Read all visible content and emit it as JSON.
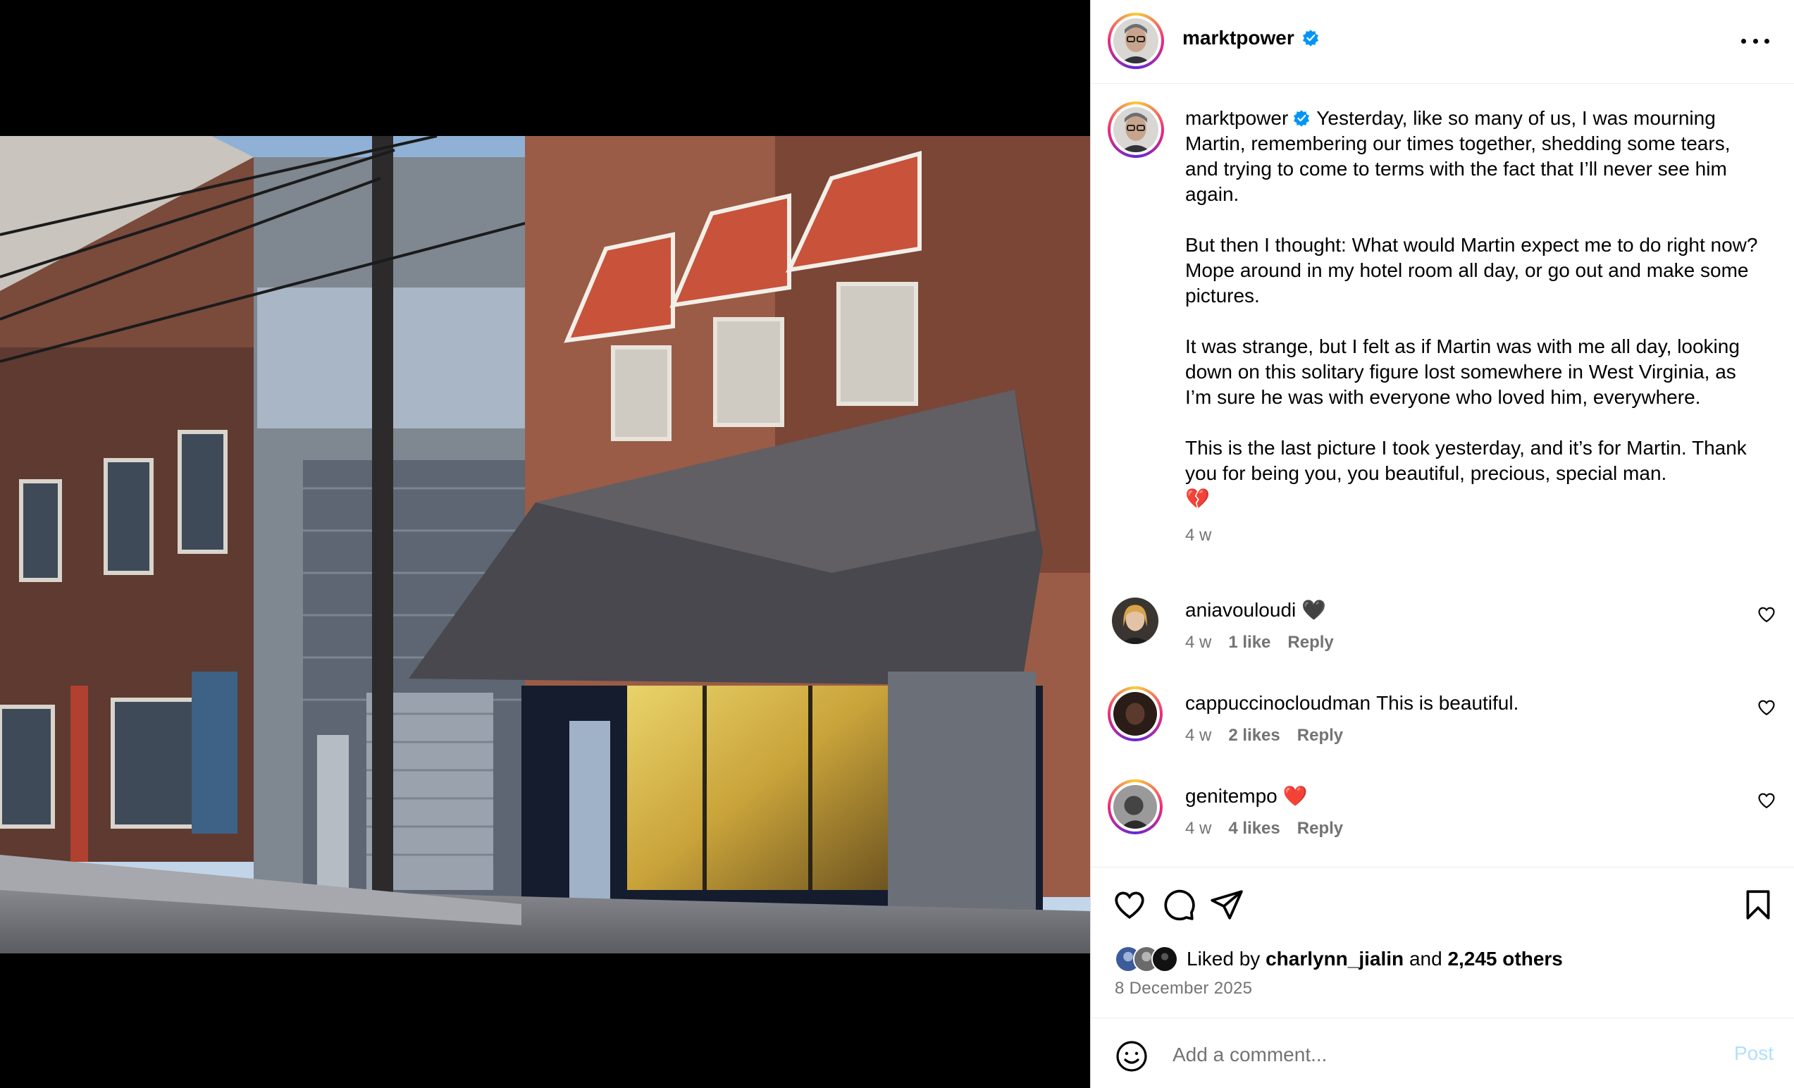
{
  "post": {
    "author": "marktpower",
    "caption_username": "marktpower",
    "caption_paragraphs": [
      "Yesterday, like so many of us, I was mourning Martin, remembering our times together, shedding some tears, and trying to come to terms with the fact that I’ll never see him again.",
      "But then I thought: What would Martin expect me to do right now? Mope around in my hotel room all day, or go out and make some pictures.",
      "It was strange, but I felt as if Martin was with me all day, looking down on this solitary figure lost somewhere in West Virginia, as I’m sure he was with everyone who loved him, everywhere.",
      "This is the last picture I took yesterday, and it’s for Martin. Thank you for being you, you beautiful, precious, special man."
    ],
    "caption_emoji": "💔",
    "caption_time": "4 w",
    "date": "8 December 2025"
  },
  "comments": [
    {
      "user": "aniavouloudi",
      "text": "🖤",
      "time": "4 w",
      "likes": "1 like",
      "reply": "Reply"
    },
    {
      "user": "cappuccinocloudman",
      "text": "This is beautiful.",
      "time": "4 w",
      "likes": "2 likes",
      "reply": "Reply"
    },
    {
      "user": "genitempo",
      "text": "❤️",
      "time": "4 w",
      "likes": "4 likes",
      "reply": "Reply"
    }
  ],
  "likes": {
    "prefix": "Liked by",
    "user": "charlynn_jialin",
    "conj": "and",
    "others": "2,245 others"
  },
  "comment_box": {
    "placeholder": "Add a comment...",
    "post_label": "Post"
  },
  "icons": {
    "more": "more-horizontal-icon",
    "verified": "verified-badge-icon",
    "like": "heart-icon",
    "comment": "comment-bubble-icon",
    "share": "paper-plane-icon",
    "save": "bookmark-icon",
    "emoji": "emoji-smile-icon"
  },
  "colors": {
    "verified": "#0095f6",
    "secondary_text": "#737373",
    "post_button": "#b2dffc"
  }
}
